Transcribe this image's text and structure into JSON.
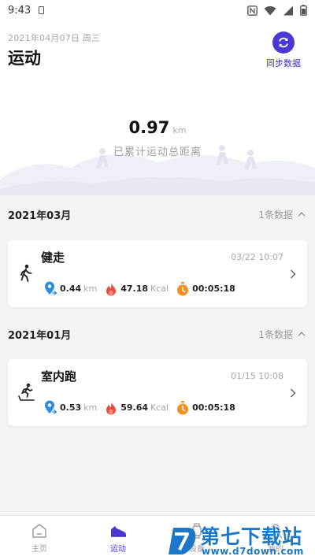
{
  "status": {
    "time": "9:43"
  },
  "header": {
    "date": "2021年04月07日 周三",
    "title": "运动",
    "sync_label": "同步数据"
  },
  "summary": {
    "distance_value": "0.97",
    "distance_unit": "km",
    "caption": "已累计运动总距离"
  },
  "months": [
    {
      "title": "2021年03月",
      "count": "1条数据",
      "record": {
        "type": "健走",
        "icon": "walking-icon",
        "time": "03/22 10:07",
        "distance": "0.44",
        "distance_unit": "km",
        "calories": "47.18",
        "calories_unit": "Kcal",
        "duration": "00:05:18"
      }
    },
    {
      "title": "2021年01月",
      "count": "1条数据",
      "record": {
        "type": "室内跑",
        "icon": "treadmill-icon",
        "time": "01/15 10:08",
        "distance": "0.53",
        "distance_unit": "km",
        "calories": "59.64",
        "calories_unit": "Kcal",
        "duration": "00:05:18"
      }
    }
  ],
  "tabs": [
    {
      "label": "主页",
      "icon": "home-icon"
    },
    {
      "label": "运动",
      "icon": "sneaker-icon",
      "active": true
    },
    {
      "label": "设备",
      "icon": "watch-icon"
    },
    {
      "label": "我的",
      "icon": "person-icon"
    }
  ],
  "watermark": {
    "title": "第七下载站",
    "url": "www.d7down.com"
  },
  "colors": {
    "accent": "#4a37d6",
    "location": "#2a8de3",
    "fire": "#f0463c",
    "timer": "#f5901e",
    "watermark": "#1b78c7"
  }
}
